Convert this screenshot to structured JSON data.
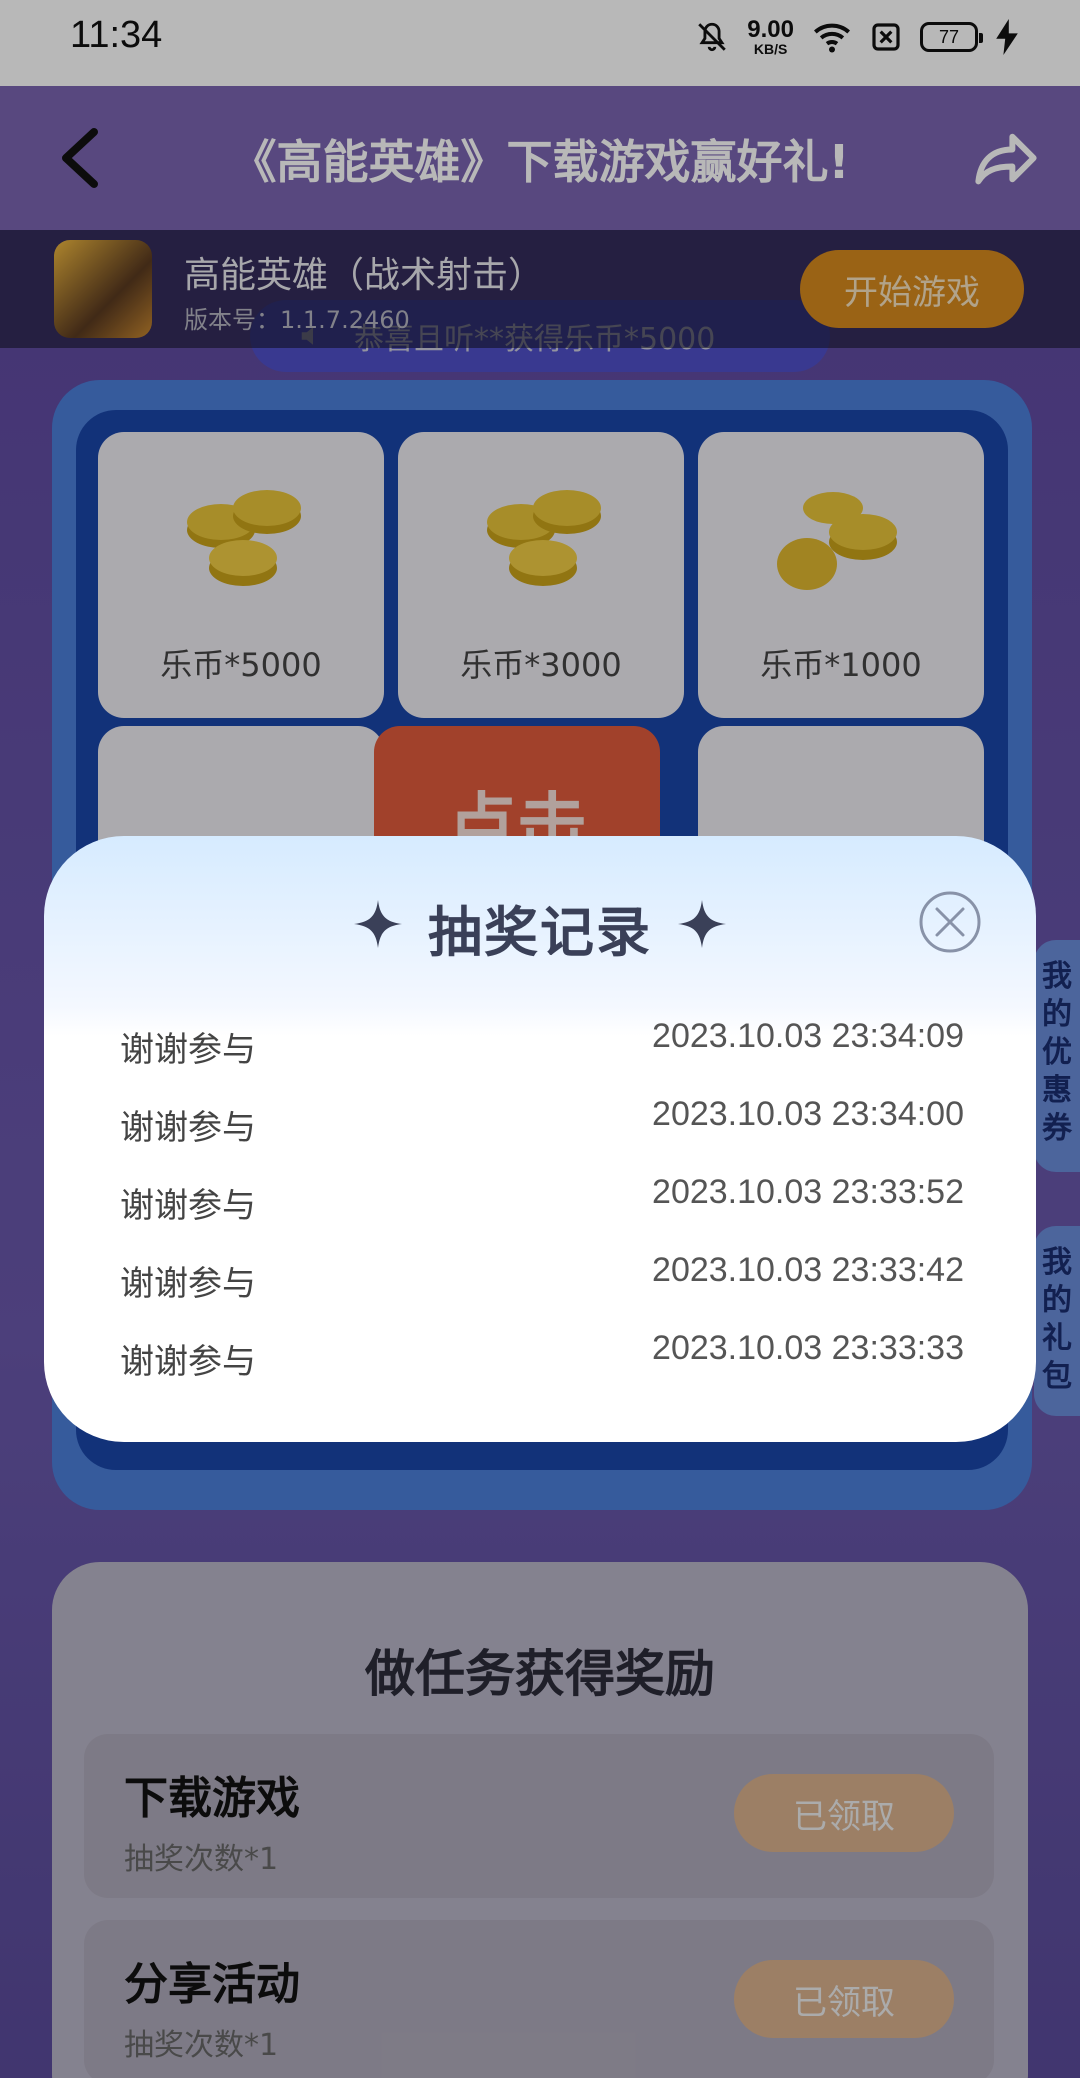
{
  "status_bar": {
    "time": "11:34",
    "net_speed": "9.00",
    "net_unit": "KB/S",
    "battery": "77"
  },
  "appbar": {
    "title": "《高能英雄》下载游戏赢好礼!"
  },
  "game": {
    "name": "高能英雄（战术射击）",
    "version": "版本号：1.1.7.2460",
    "start_label": "开始游戏"
  },
  "ticker": {
    "text": "恭喜且听**获得乐币*5000"
  },
  "prizes": [
    {
      "label": "乐币*5000"
    },
    {
      "label": "乐币*3000"
    },
    {
      "label": "乐币*1000"
    }
  ],
  "center_button": "点击",
  "side_tabs": {
    "coupons": "我的优惠券",
    "gifts": "我的礼包"
  },
  "tasks": {
    "title": "做任务获得奖励",
    "items": [
      {
        "name": "下载游戏",
        "reward": "抽奖次数*1",
        "button": "已领取"
      },
      {
        "name": "分享活动",
        "reward": "抽奖次数*1",
        "button": "已领取"
      }
    ]
  },
  "modal": {
    "title": "抽奖记录",
    "records": [
      {
        "status": "谢谢参与",
        "time": "2023.10.03 23:34:09"
      },
      {
        "status": "谢谢参与",
        "time": "2023.10.03 23:34:00"
      },
      {
        "status": "谢谢参与",
        "time": "2023.10.03 23:33:52"
      },
      {
        "status": "谢谢参与",
        "time": "2023.10.03 23:33:42"
      },
      {
        "status": "谢谢参与",
        "time": "2023.10.03 23:33:33"
      }
    ]
  },
  "icons": {
    "back": "back-arrow-icon",
    "share": "share-icon",
    "close": "close-icon",
    "mute": "bell-off-icon",
    "wifi": "wifi-icon",
    "sim": "sim-off-icon",
    "charging": "charging-icon"
  }
}
